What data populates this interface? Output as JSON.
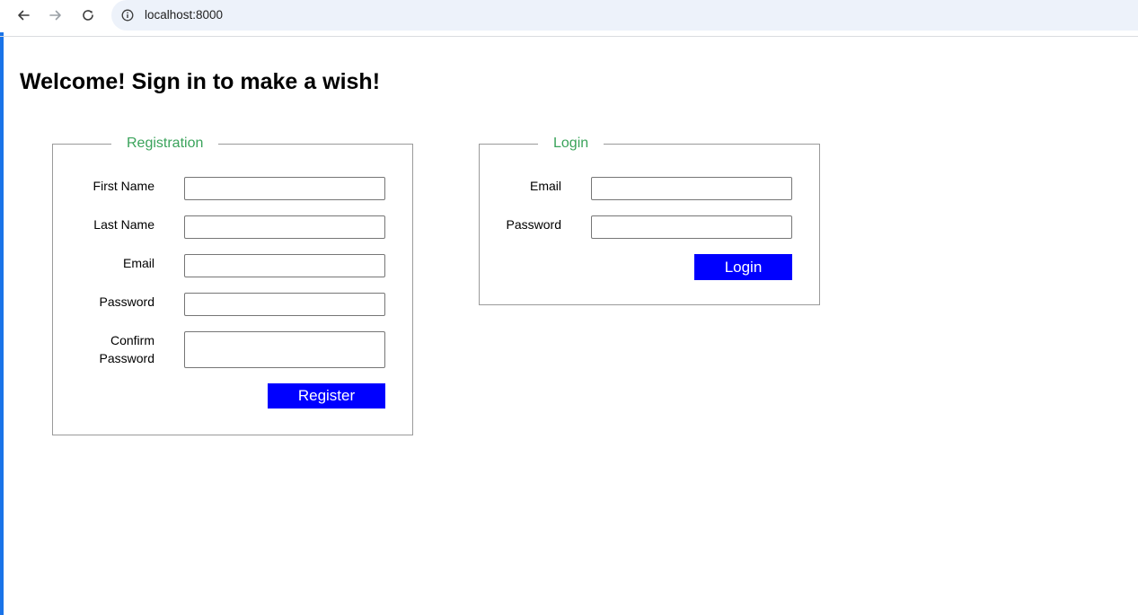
{
  "browser": {
    "url": "localhost:8000",
    "icons": {
      "back": "arrow-left-icon",
      "forward": "arrow-right-icon",
      "reload": "reload-icon",
      "site_info": "info-icon"
    }
  },
  "page": {
    "title": "Welcome! Sign in to make a wish!"
  },
  "registration": {
    "legend": "Registration",
    "fields": {
      "first_name": {
        "label": "First Name",
        "value": ""
      },
      "last_name": {
        "label": "Last Name",
        "value": ""
      },
      "email": {
        "label": "Email",
        "value": ""
      },
      "password": {
        "label": "Password",
        "value": ""
      },
      "confirm_password": {
        "label_line1": "Confirm",
        "label_line2": "Password",
        "value": ""
      }
    },
    "submit_label": "Register"
  },
  "login": {
    "legend": "Login",
    "fields": {
      "email": {
        "label": "Email",
        "value": ""
      },
      "password": {
        "label": "Password",
        "value": ""
      }
    },
    "submit_label": "Login"
  },
  "colors": {
    "legend": "#3aa35b",
    "button_bg": "#0000ff",
    "button_text": "#ffffff",
    "accent_strip": "#1a73e8"
  }
}
